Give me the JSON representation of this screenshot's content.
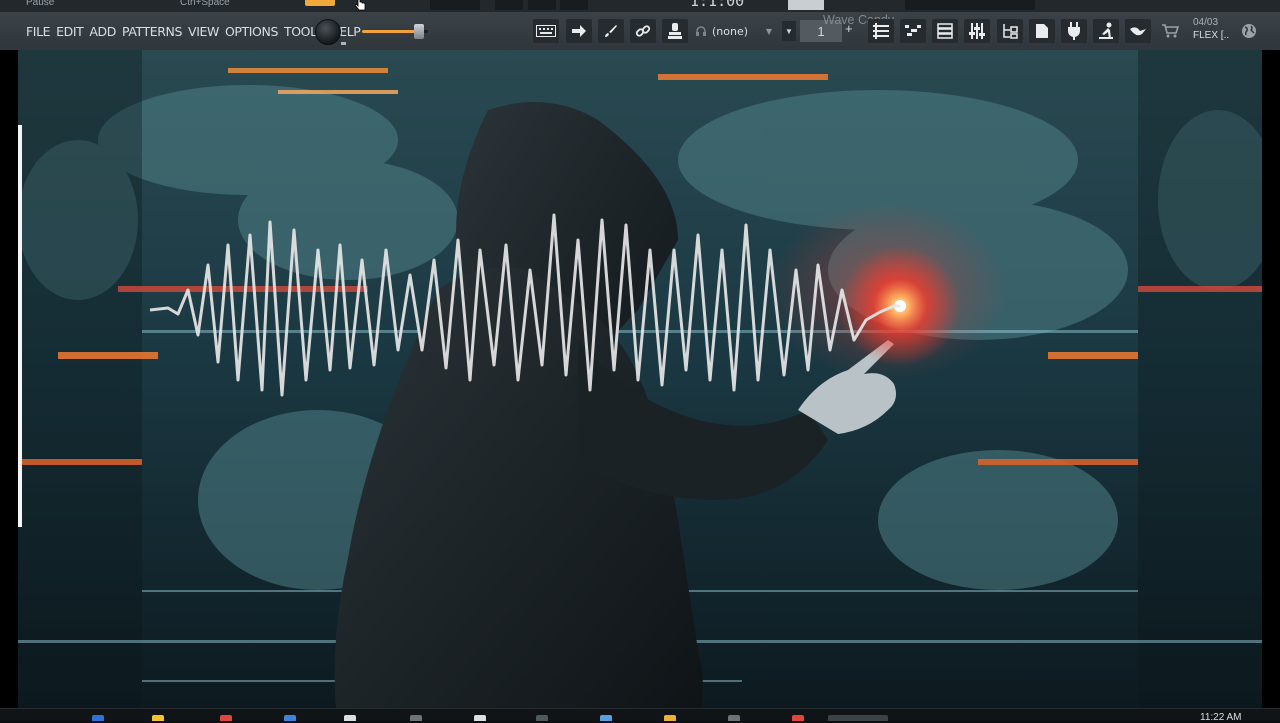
{
  "title_strip": {
    "left_text": "Pause",
    "shortcut_hint": "Ctrl+Space",
    "bpm_display": "1:1:00"
  },
  "menu": {
    "items": [
      "FILE",
      "EDIT",
      "ADD",
      "PATTERNS",
      "VIEW",
      "OPTIONS",
      "TOOLS",
      "HELP"
    ]
  },
  "toolbar": {
    "pattern_selector": "(none)",
    "plugin_label": "Wave Candy",
    "number_box": "1",
    "plus": "+",
    "date": "04/03",
    "flex_label": "FLEX [.."
  },
  "taskbar": {
    "clock": "11:22 AM"
  },
  "colors": {
    "toolbar_bg": "#353c41",
    "accent_orange": "#f3a23a",
    "menu_text": "#d9dfe3",
    "waveform": "#e6e6e6",
    "glow_red": "#ff3b2b"
  },
  "icons": {
    "keyboard": "keyboard-icon",
    "arrow": "arrow-right-icon",
    "brush": "brush-icon",
    "link": "link-icon",
    "stamp": "stamp-icon",
    "headphones": "headphones-icon"
  }
}
